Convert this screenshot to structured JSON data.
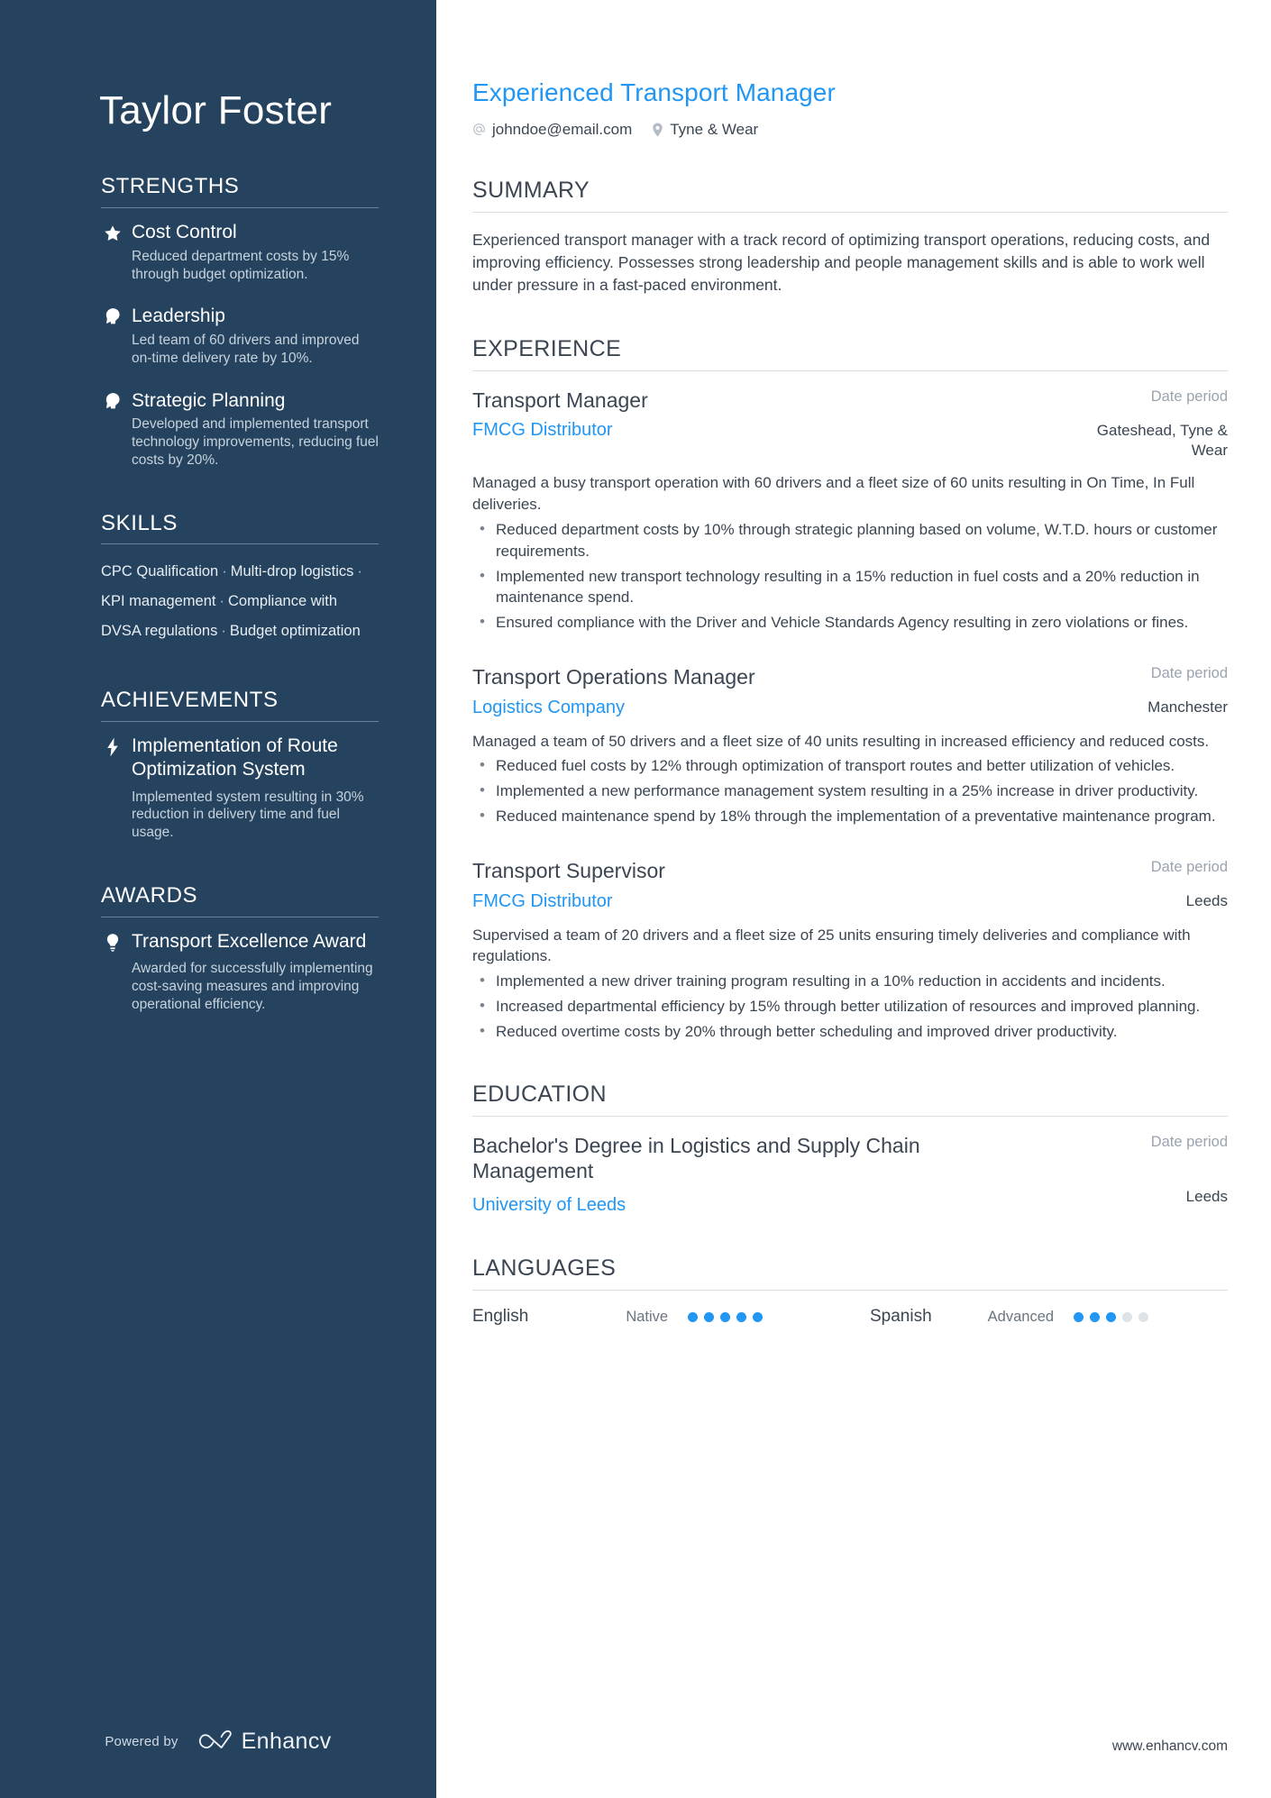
{
  "sidebar": {
    "name": "Taylor Foster",
    "sections": {
      "strengths": {
        "heading": "STRENGTHS",
        "items": [
          {
            "icon": "star-icon",
            "title": "Cost Control",
            "desc": "Reduced department costs by 15% through budget optimization."
          },
          {
            "icon": "head-idea-icon",
            "title": "Leadership",
            "desc": "Led team of 60 drivers and improved on-time delivery rate by 10%."
          },
          {
            "icon": "head-idea-icon",
            "title": "Strategic Planning",
            "desc": "Developed and implemented transport technology improvements, reducing fuel costs by 20%."
          }
        ]
      },
      "skills": {
        "heading": "SKILLS",
        "separator": "·",
        "items": [
          "CPC Qualification",
          "Multi-drop logistics",
          "KPI management",
          "Compliance with DVSA regulations",
          "Budget optimization"
        ]
      },
      "achievements": {
        "heading": "ACHIEVEMENTS",
        "items": [
          {
            "icon": "lightning-bolt-icon",
            "title": "Implementation of Route Optimization System",
            "desc": "Implemented system resulting in 30% reduction in delivery time and fuel usage."
          }
        ]
      },
      "awards": {
        "heading": "AWARDS",
        "items": [
          {
            "icon": "lightbulb-icon",
            "title": "Transport Excellence Award",
            "desc": "Awarded for successfully implementing cost-saving measures and improving operational efficiency."
          }
        ]
      }
    },
    "footer": {
      "powered_by": "Powered by",
      "brand": "Enhancv",
      "logo_icon": "enhancv-infinity-logo"
    }
  },
  "main": {
    "headline": "Experienced Transport Manager",
    "contact": {
      "email": "johndoe@email.com",
      "email_icon": "at-sign-icon",
      "location": "Tyne & Wear",
      "location_icon": "map-pin-icon"
    },
    "summary": {
      "heading": "SUMMARY",
      "text": "Experienced transport manager with a track record of optimizing transport operations, reducing costs, and improving efficiency. Possesses strong leadership and people management skills and is able to work well under pressure in a fast-paced environment."
    },
    "experience": {
      "heading": "EXPERIENCE",
      "jobs": [
        {
          "title": "Transport Manager",
          "company": "FMCG Distributor",
          "date": "Date period",
          "location": "Gateshead, Tyne & Wear",
          "summary": "Managed a busy transport operation with 60 drivers and a fleet size of 60 units resulting in On Time, In Full deliveries.",
          "bullets": [
            "Reduced department costs by 10% through strategic planning based on volume, W.T.D. hours or customer requirements.",
            "Implemented new transport technology resulting in a 15% reduction in fuel costs and a 20% reduction in maintenance spend.",
            "Ensured compliance with the Driver and Vehicle Standards Agency resulting in zero violations or fines."
          ]
        },
        {
          "title": "Transport Operations Manager",
          "company": "Logistics Company",
          "date": "Date period",
          "location": "Manchester",
          "summary": "Managed a team of 50 drivers and a fleet size of 40 units resulting in increased efficiency and reduced costs.",
          "bullets": [
            "Reduced fuel costs by 12% through optimization of transport routes and better utilization of vehicles.",
            "Implemented a new performance management system resulting in a 25% increase in driver productivity.",
            "Reduced maintenance spend by 18% through the implementation of a preventative maintenance program."
          ]
        },
        {
          "title": "Transport Supervisor",
          "company": "FMCG Distributor",
          "date": "Date period",
          "location": "Leeds",
          "summary": "Supervised a team of 20 drivers and a fleet size of 25 units ensuring timely deliveries and compliance with regulations.",
          "bullets": [
            "Implemented a new driver training program resulting in a 10% reduction in accidents and incidents.",
            "Increased departmental efficiency by 15% through better utilization of resources and improved planning.",
            "Reduced overtime costs by 20% through better scheduling and improved driver productivity."
          ]
        }
      ]
    },
    "education": {
      "heading": "EDUCATION",
      "items": [
        {
          "degree": "Bachelor's Degree in Logistics and Supply Chain Management",
          "school": "University of Leeds",
          "date": "Date period",
          "location": "Leeds"
        }
      ]
    },
    "languages": {
      "heading": "LANGUAGES",
      "items": [
        {
          "name": "English",
          "level": "Native",
          "filled": 5,
          "total": 5
        },
        {
          "name": "Spanish",
          "level": "Advanced",
          "filled": 3,
          "total": 5
        }
      ]
    },
    "website": "www.enhancv.com"
  },
  "colors": {
    "sidebar_bg": "#25435f",
    "accent_blue": "#2196f3",
    "body_text": "#3b4652",
    "muted_text": "#9aa4ae"
  }
}
